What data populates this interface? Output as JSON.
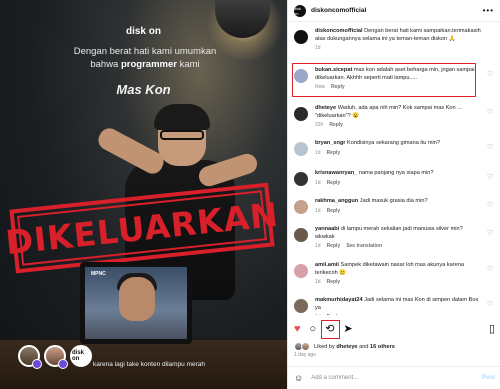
{
  "post": {
    "brand": "disk on",
    "headline_part1": "Dengan berat hati kami umumkan",
    "headline_part2": "bahwa",
    "headline_bold": "programmer",
    "headline_part3": "kami",
    "name": "Mas Kon",
    "stamp": "DIKELUARKAN",
    "laptop_logo": "MPNC",
    "caption": "karena lagi take konten dilampu merah",
    "avatar_logo": "disk on"
  },
  "header": {
    "username": "diskoncomofficial",
    "avatar_label": "disk on",
    "menu": "•••"
  },
  "caption_comment": {
    "username": "diskoncomofficial",
    "text": "Dengan berat hati kami sampaikan.terimakasih atas dukungannya selama ini ya teman-teman diskon 🙏",
    "time": "1d"
  },
  "comments": [
    {
      "username": "bukan.sicepat",
      "text": "mas kon adalah aset beharga min, jngan sampai dikeluarkan. Akhhh seperti mati lampu.....",
      "time": "Now",
      "reply": "Reply",
      "likes": "",
      "color": "#9aa8c8"
    },
    {
      "username": "dheteye",
      "text": "Waduh, ada apa nih min? Kok sampai mas Kon ... \"dikeluarkan\"? 😮",
      "time": "22h",
      "reply": "Reply",
      "likes": "",
      "color": "#2a2a2a"
    },
    {
      "username": "bryan_sngr",
      "text": "Kondisinya sekarang gimana itu min?",
      "time": "1d",
      "reply": "Reply",
      "likes": "",
      "color": "#b8c4d0"
    },
    {
      "username": "krisnawanryan_",
      "text": "nama panjang nya siapa min?",
      "time": "1d",
      "reply": "Reply",
      "likes": "",
      "color": "#333333"
    },
    {
      "username": "rakhma_anggun",
      "text": "Jadi masuk grasia dia min?",
      "time": "1d",
      "reply": "Reply",
      "likes": "",
      "color": "#c6a08a"
    },
    {
      "username": "yannaabi",
      "text": "di lampu merah sekalian jadi manusia silver min? wkwkak",
      "time": "1d",
      "reply": "Reply",
      "likes": "",
      "color": "#6a5a4a",
      "extra": "See translation"
    },
    {
      "username": "amii.amii",
      "text": "Sampek diketawain nasar loh mas akunya karena terikecoh 🥲",
      "time": "1d",
      "reply": "Reply",
      "likes": "",
      "color": "#d8a0a8"
    },
    {
      "username": "makmurhidayat24",
      "text": "Jadi selama ini mas Kon di simpen dalam Box ya",
      "time": "1d",
      "reply": "Reply",
      "likes": "",
      "color": "#7a6a5a"
    }
  ],
  "actions": {
    "like_icon": "♥",
    "comment_icon": "○",
    "repost_icon": "⟲",
    "share_icon": "➤",
    "save_icon": "▯"
  },
  "likes": {
    "prefix": "Liked by",
    "user": "dheteye",
    "conj": "and",
    "others": "16 others"
  },
  "time_ago": "1 day ago",
  "add_comment": {
    "emoji_icon": "☺",
    "placeholder": "Add a comment...",
    "post_label": "Post"
  },
  "colors": {
    "accent_red": "#e0202a",
    "like_red": "#ed4956",
    "stamp_red": "#d8202b",
    "post_button": "#b3dbff"
  }
}
